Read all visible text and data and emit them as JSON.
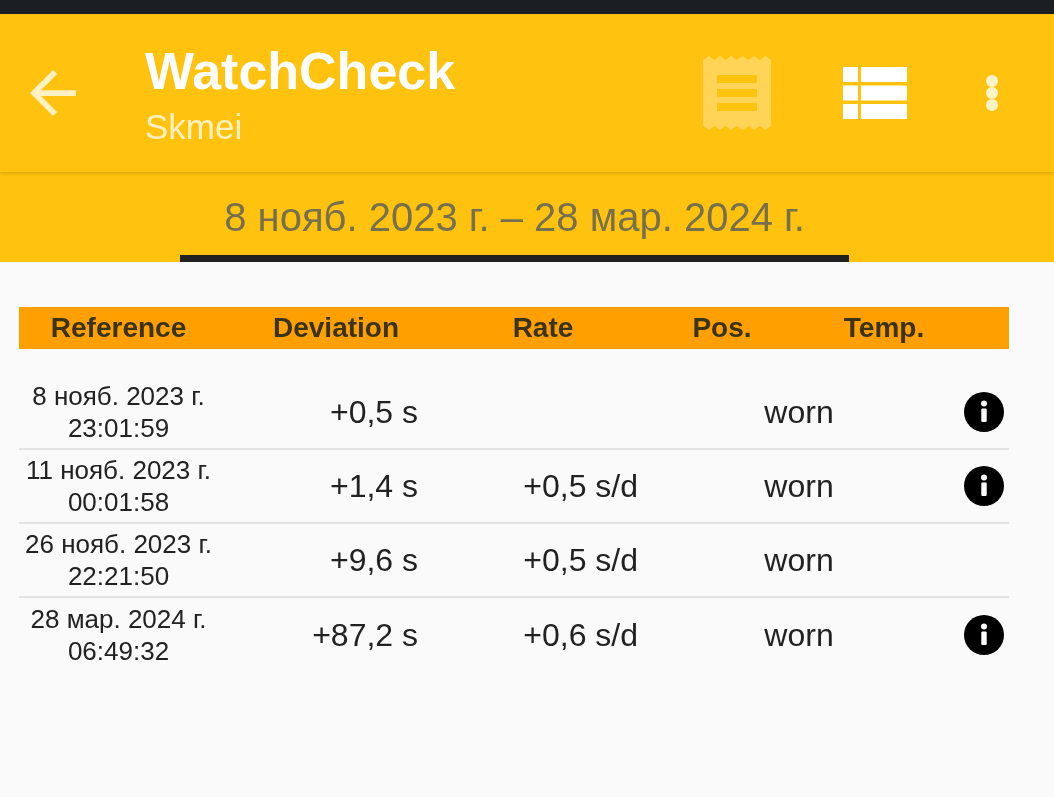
{
  "app_bar": {
    "title": "WatchCheck",
    "subtitle": "Skmei",
    "actions": [
      {
        "kind": "receipt",
        "disabled": true
      },
      {
        "kind": "list",
        "disabled": false
      },
      {
        "kind": "overflow",
        "disabled": false
      }
    ]
  },
  "tabs": [
    {
      "label": "8 нояб. 2023 г. – 28 мар. 2024 г.",
      "selected": true
    }
  ],
  "table": {
    "columns": [
      "Reference",
      "Deviation",
      "Rate",
      "Pos.",
      "Temp."
    ],
    "rows": [
      {
        "reference_date": "8 нояб. 2023 г.",
        "reference_time": "23:01:59",
        "deviation": "+0,5 s",
        "position": "worn",
        "info": true
      },
      {
        "reference_date": "11 нояб. 2023 г.",
        "reference_time": "00:01:58",
        "deviation": "+1,4 s",
        "rate": "+0,5 s/d",
        "position": "worn",
        "info": true
      },
      {
        "reference_date": "26 нояб. 2023 г.",
        "reference_time": "22:21:50",
        "deviation": "+9,6 s",
        "rate": "+0,5 s/d",
        "position": "worn",
        "info": false
      },
      {
        "reference_date": "28 мар. 2024 г.",
        "reference_time": "06:49:32",
        "deviation": "+87,2 s",
        "rate": "+0,6 s/d",
        "position": "worn",
        "info": true
      }
    ]
  }
}
